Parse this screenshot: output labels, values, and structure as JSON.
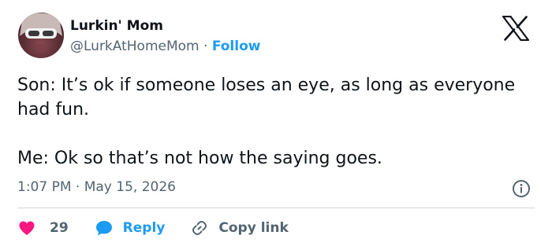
{
  "author": {
    "name": "Lurkin' Mom",
    "handle": "@LurkAtHomeMom",
    "separator": "·",
    "follow_label": "Follow"
  },
  "tweet": {
    "paragraphs": [
      "Son: It’s ok if someone loses an eye, as long as everyone had fun.",
      "Me: Ok so that’s not how the saying goes."
    ],
    "time": "1:07 PM",
    "separator": "·",
    "date": "May 15, 2026"
  },
  "actions": {
    "like_count": "29",
    "reply_label": "Reply",
    "copy_label": "Copy link"
  },
  "icons": {
    "platform": "x-logo-icon",
    "info": "info-icon",
    "like": "heart-icon",
    "reply": "speech-bubble-icon",
    "copy": "link-icon"
  },
  "colors": {
    "accent": "#1d9bf0",
    "like": "#f91880",
    "text": "#0f1419",
    "muted": "#536471",
    "divider": "#cfd9de"
  }
}
